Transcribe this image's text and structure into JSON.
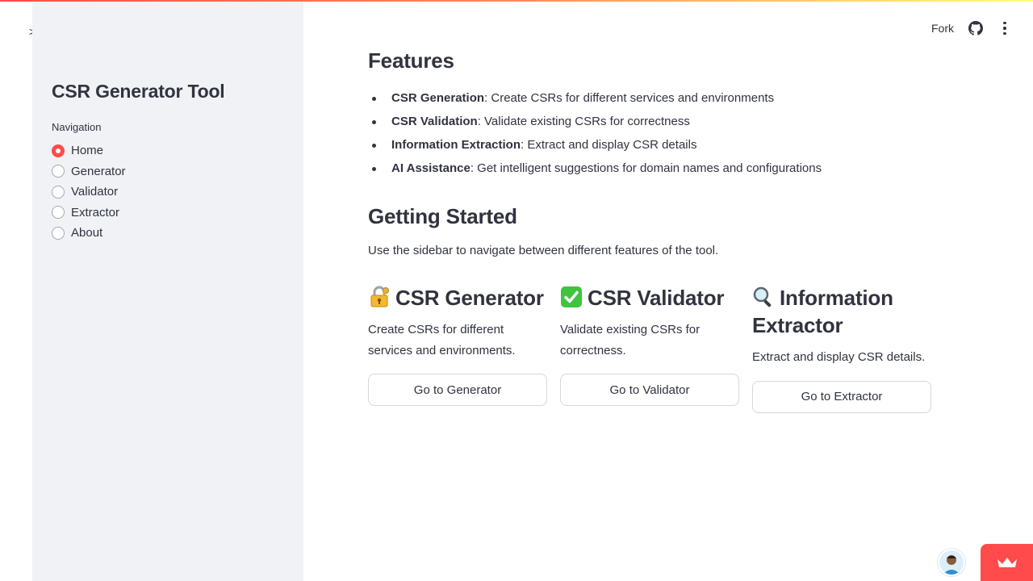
{
  "sidebar": {
    "title": "CSR Generator Tool",
    "nav_label": "Navigation",
    "items": [
      {
        "label": "Home",
        "selected": true
      },
      {
        "label": "Generator",
        "selected": false
      },
      {
        "label": "Validator",
        "selected": false
      },
      {
        "label": "Extractor",
        "selected": false
      },
      {
        "label": "About",
        "selected": false
      }
    ]
  },
  "header": {
    "fork_label": "Fork",
    "icons": [
      "github-icon",
      "more-vertical-icon"
    ]
  },
  "main": {
    "features_title": "Features",
    "features": [
      {
        "name": "CSR Generation",
        "desc": ": Create CSRs for different services and environments"
      },
      {
        "name": "CSR Validation",
        "desc": ": Validate existing CSRs for correctness"
      },
      {
        "name": "Information Extraction",
        "desc": ": Extract and display CSR details"
      },
      {
        "name": "AI Assistance",
        "desc": ": Get intelligent suggestions for domain names and configurations"
      }
    ],
    "getting_started_title": "Getting Started",
    "intro": "Use the sidebar to navigate between different features of the tool.",
    "cards": [
      {
        "icon": "lock-with-key-icon",
        "title": "CSR Generator",
        "desc": "Create CSRs for different services and environments.",
        "button": "Go to Generator"
      },
      {
        "icon": "check-mark-icon",
        "title": "CSR Validator",
        "desc": "Validate existing CSRs for correctness.",
        "button": "Go to Validator"
      },
      {
        "icon": "magnifying-glass-icon",
        "title": "Information Extractor",
        "desc": "Extract and display CSR details.",
        "button": "Go to Extractor"
      }
    ]
  },
  "colors": {
    "accent": "#ff4b4b",
    "sidebar_bg": "#f0f2f6",
    "text": "#31333f",
    "check_green": "#3ec43e"
  }
}
